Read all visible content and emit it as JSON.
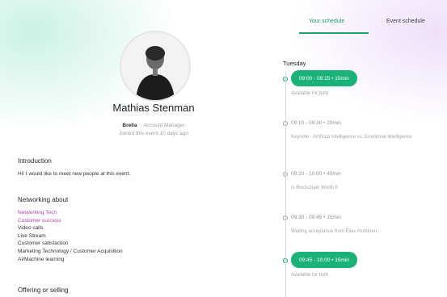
{
  "colors": {
    "accent": "#18a46a",
    "highlight": "#b63fae",
    "pill": "#1bb27a"
  },
  "profile": {
    "name": "Mathias Stenman",
    "company": "Brella",
    "separator": "·",
    "role": "Account Manager",
    "joined": "Joined this event 10 days ago"
  },
  "intro": {
    "title": "Introduction",
    "text": "Hi! I would like to meet new people at this event."
  },
  "networking": {
    "title": "Networking about",
    "items": [
      {
        "label": "Networking Tech"
      },
      {
        "label": "Customer success"
      },
      {
        "label": "Video calls"
      },
      {
        "label": "Live Stream"
      },
      {
        "label": "Customer satisfaction"
      },
      {
        "label": "Marketing Technology / Customer Acquisition"
      },
      {
        "label": "AI/Machine learning"
      }
    ]
  },
  "offering": {
    "title": "Offering or selling"
  },
  "schedule": {
    "tabs": [
      {
        "label": "Your schedule"
      },
      {
        "label": "Event schedule"
      }
    ],
    "day": "Tuesday",
    "slots": [
      {
        "time": "09:00 - 09:15 • 15min",
        "desc": "Available for both",
        "highlight": true
      },
      {
        "time": "09:10 - 09:30 • 20min",
        "desc": "Keynote - Artificial Intelligence vs. Emotional Intelligence",
        "highlight": false
      },
      {
        "time": "09:20 - 10:00 • 40min",
        "desc": "Is Blockchain Worth It",
        "highlight": false
      },
      {
        "time": "09:30 - 09:45 • 15min",
        "desc": "Waiting acceptance from Elias Huhtinen",
        "highlight": false
      },
      {
        "time": "09:45 - 10:00 • 15min",
        "desc": "Available for both",
        "highlight": true
      }
    ]
  }
}
